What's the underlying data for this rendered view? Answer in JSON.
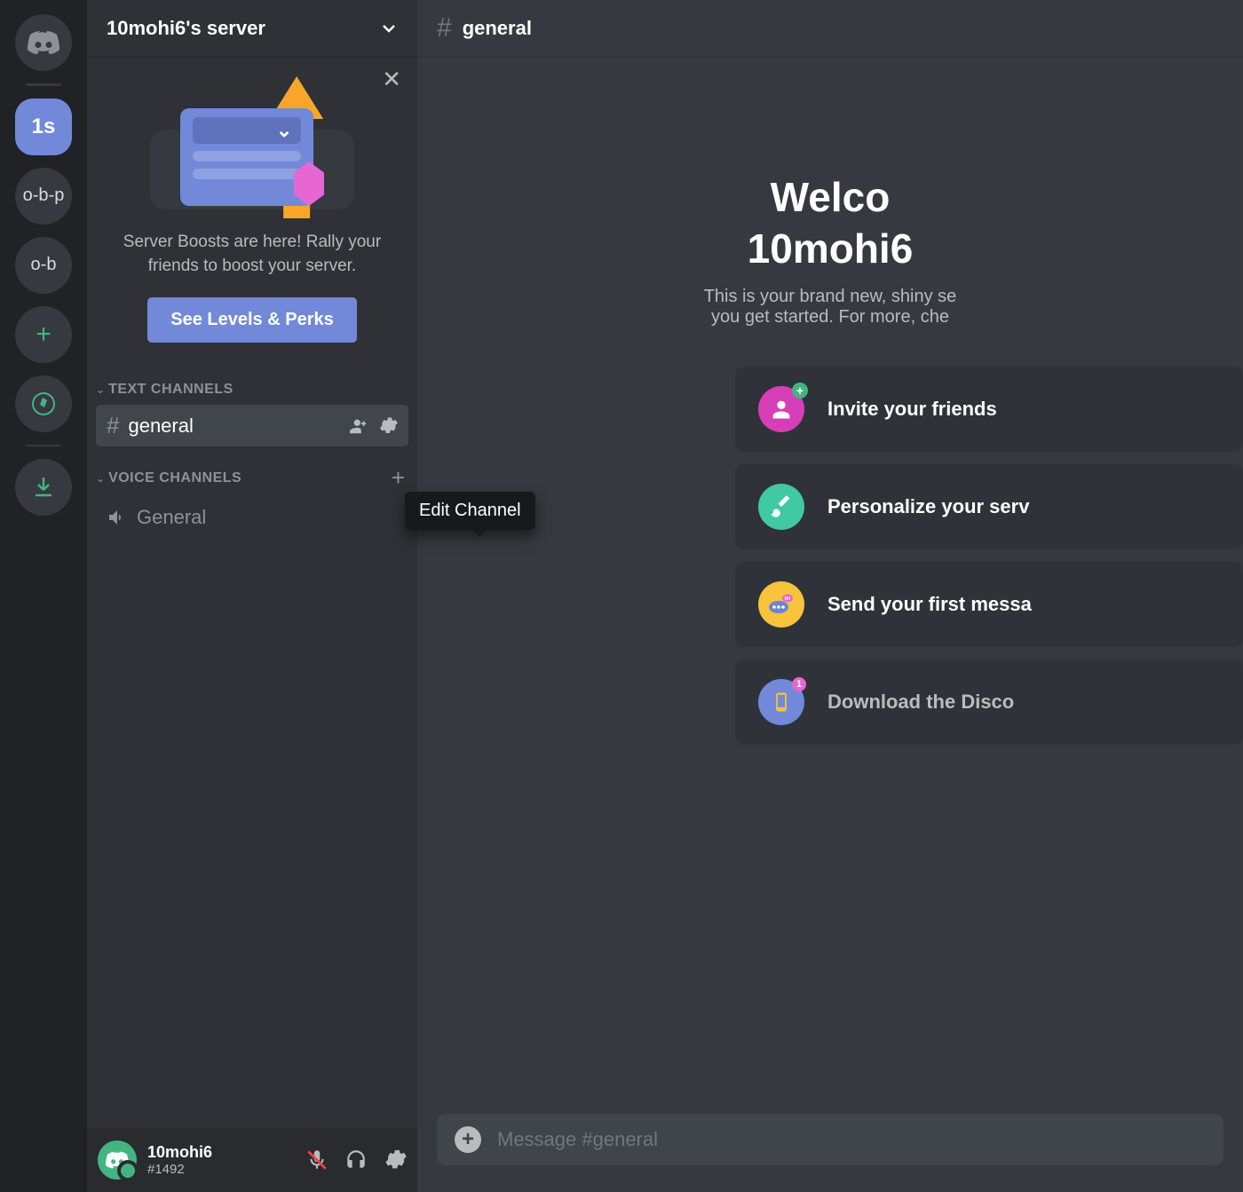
{
  "rail": {
    "servers": [
      {
        "label": "1s",
        "selected": true
      },
      {
        "label": "o-b-p",
        "selected": false
      },
      {
        "label": "o-b",
        "selected": false
      }
    ]
  },
  "server": {
    "name": "10mohi6's server"
  },
  "boost": {
    "text": "Server Boosts are here! Rally your friends to boost your server.",
    "button": "See Levels & Perks"
  },
  "categories": {
    "text": {
      "name": "TEXT CHANNELS"
    },
    "voice": {
      "name": "VOICE CHANNELS"
    }
  },
  "channels": {
    "general": "general",
    "voice_general": "General"
  },
  "tooltip": {
    "edit_channel": "Edit Channel"
  },
  "user": {
    "name": "10mohi6",
    "tag": "#1492"
  },
  "chat": {
    "channel": "general",
    "welcome_line1": "Welco",
    "welcome_line2_prefix": "10mohi6",
    "subtitle_line1": "This is your brand new, shiny se",
    "subtitle_line2": "you get started. For more, che",
    "compose_placeholder": "Message #general"
  },
  "action_cards": {
    "invite": "Invite your friends",
    "personalize": "Personalize your serv",
    "send": "Send your first messa",
    "download": "Download the Disco"
  }
}
